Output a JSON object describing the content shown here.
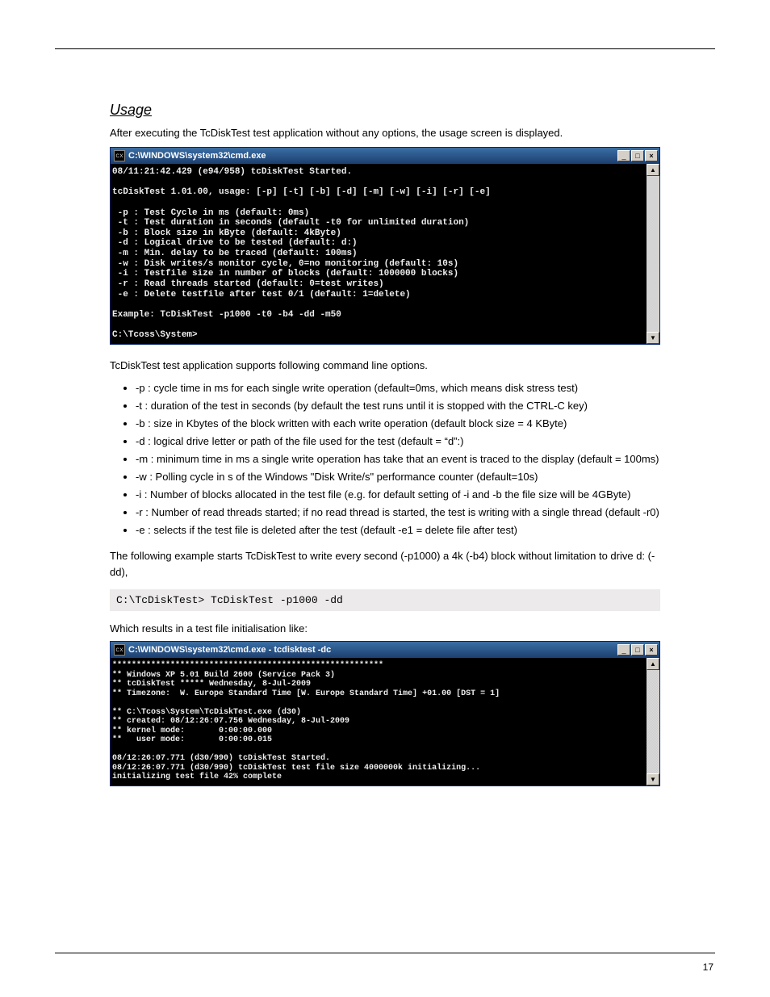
{
  "page_number": "17",
  "section_heading": "Usage",
  "lead_text": "After executing the TcDiskTest test application without any options, the usage screen is displayed.",
  "cmd1": {
    "title": "C:\\WINDOWS\\system32\\cmd.exe",
    "icon_text": "cx",
    "lines": [
      "08/11:21:42.429 (e94/958) tcDiskTest Started.",
      "",
      "tcDiskTest 1.01.00, usage: [-p] [-t] [-b] [-d] [-m] [-w] [-i] [-r] [-e]",
      "",
      " -p : Test Cycle in ms (default: 0ms)",
      " -t : Test duration in seconds (default -t0 for unlimited duration)",
      " -b : Block size in kByte (default: 4kByte)",
      " -d : Logical drive to be tested (default: d:)",
      " -m : Min. delay to be traced (default: 100ms)",
      " -w : Disk writes/s monitor cycle, 0=no monitoring (default: 10s)",
      " -i : Testfile size in number of blocks (default: 1000000 blocks)",
      " -r : Read threads started (default: 0=test writes)",
      " -e : Delete testfile after test 0/1 (default: 1=delete)",
      "",
      "Example: TcDiskTest -p1000 -t0 -b4 -dd -m50",
      "",
      "C:\\Tcoss\\System>"
    ]
  },
  "options_intro": "TcDiskTest test application supports following command line options.",
  "options": [
    "-p : cycle time in ms for each single write operation (default=0ms, which means disk stress test)",
    "-t : duration of the test in seconds (by default the test runs until it is stopped with the CTRL-C key)",
    "-b : size in Kbytes of the block written with each write operation (default block size = 4 KByte)",
    "-d : logical drive letter or path of the file used for the test (default = “d”:)",
    "-m : minimum time in ms a single write operation has take that an event is traced to the display (default = 100ms)",
    "-w : Polling cycle in s of the Windows \"Disk Write/s\" performance counter (default=10s)",
    "-i : Number of blocks allocated in the test file (e.g. for default setting of -i and -b the file size will be 4GByte)",
    "-r : Number of read threads started; if no read thread is started, the test is writing with a single thread (default -r0)",
    "-e : selects if the test file is deleted after the test (default -e1 = delete file after test)"
  ],
  "additional_text": "The following example starts TcDiskTest  to write every second (-p1000)  a 4k (-b4)  block without limitation to drive d: (-dd),",
  "cmdline": "C:\\TcDiskTest> TcDiskTest -p1000 -dd",
  "caption2": "Which results in a test file initialisation like:",
  "cmd2": {
    "title": "C:\\WINDOWS\\system32\\cmd.exe - tcdisktest -dc",
    "icon_text": "cx",
    "lines": [
      "********************************************************",
      "** Windows XP 5.01 Build 2600 (Service Pack 3)",
      "** tcDiskTest ***** Wednesday, 8-Jul-2009",
      "** Timezone:  W. Europe Standard Time [W. Europe Standard Time] +01.00 [DST = 1]",
      "",
      "** C:\\Tcoss\\System\\TcDiskTest.exe (d30)",
      "** created: 08/12:26:07.756 Wednesday, 8-Jul-2009",
      "** kernel mode:       0:00:00.000",
      "**   user mode:       0:00:00.015",
      "",
      "08/12:26:07.771 (d30/990) tcDiskTest Started.",
      "08/12:26:07.771 (d30/990) tcDiskTest test file size 4000000k initializing...",
      "initializing test file 42% complete"
    ]
  }
}
